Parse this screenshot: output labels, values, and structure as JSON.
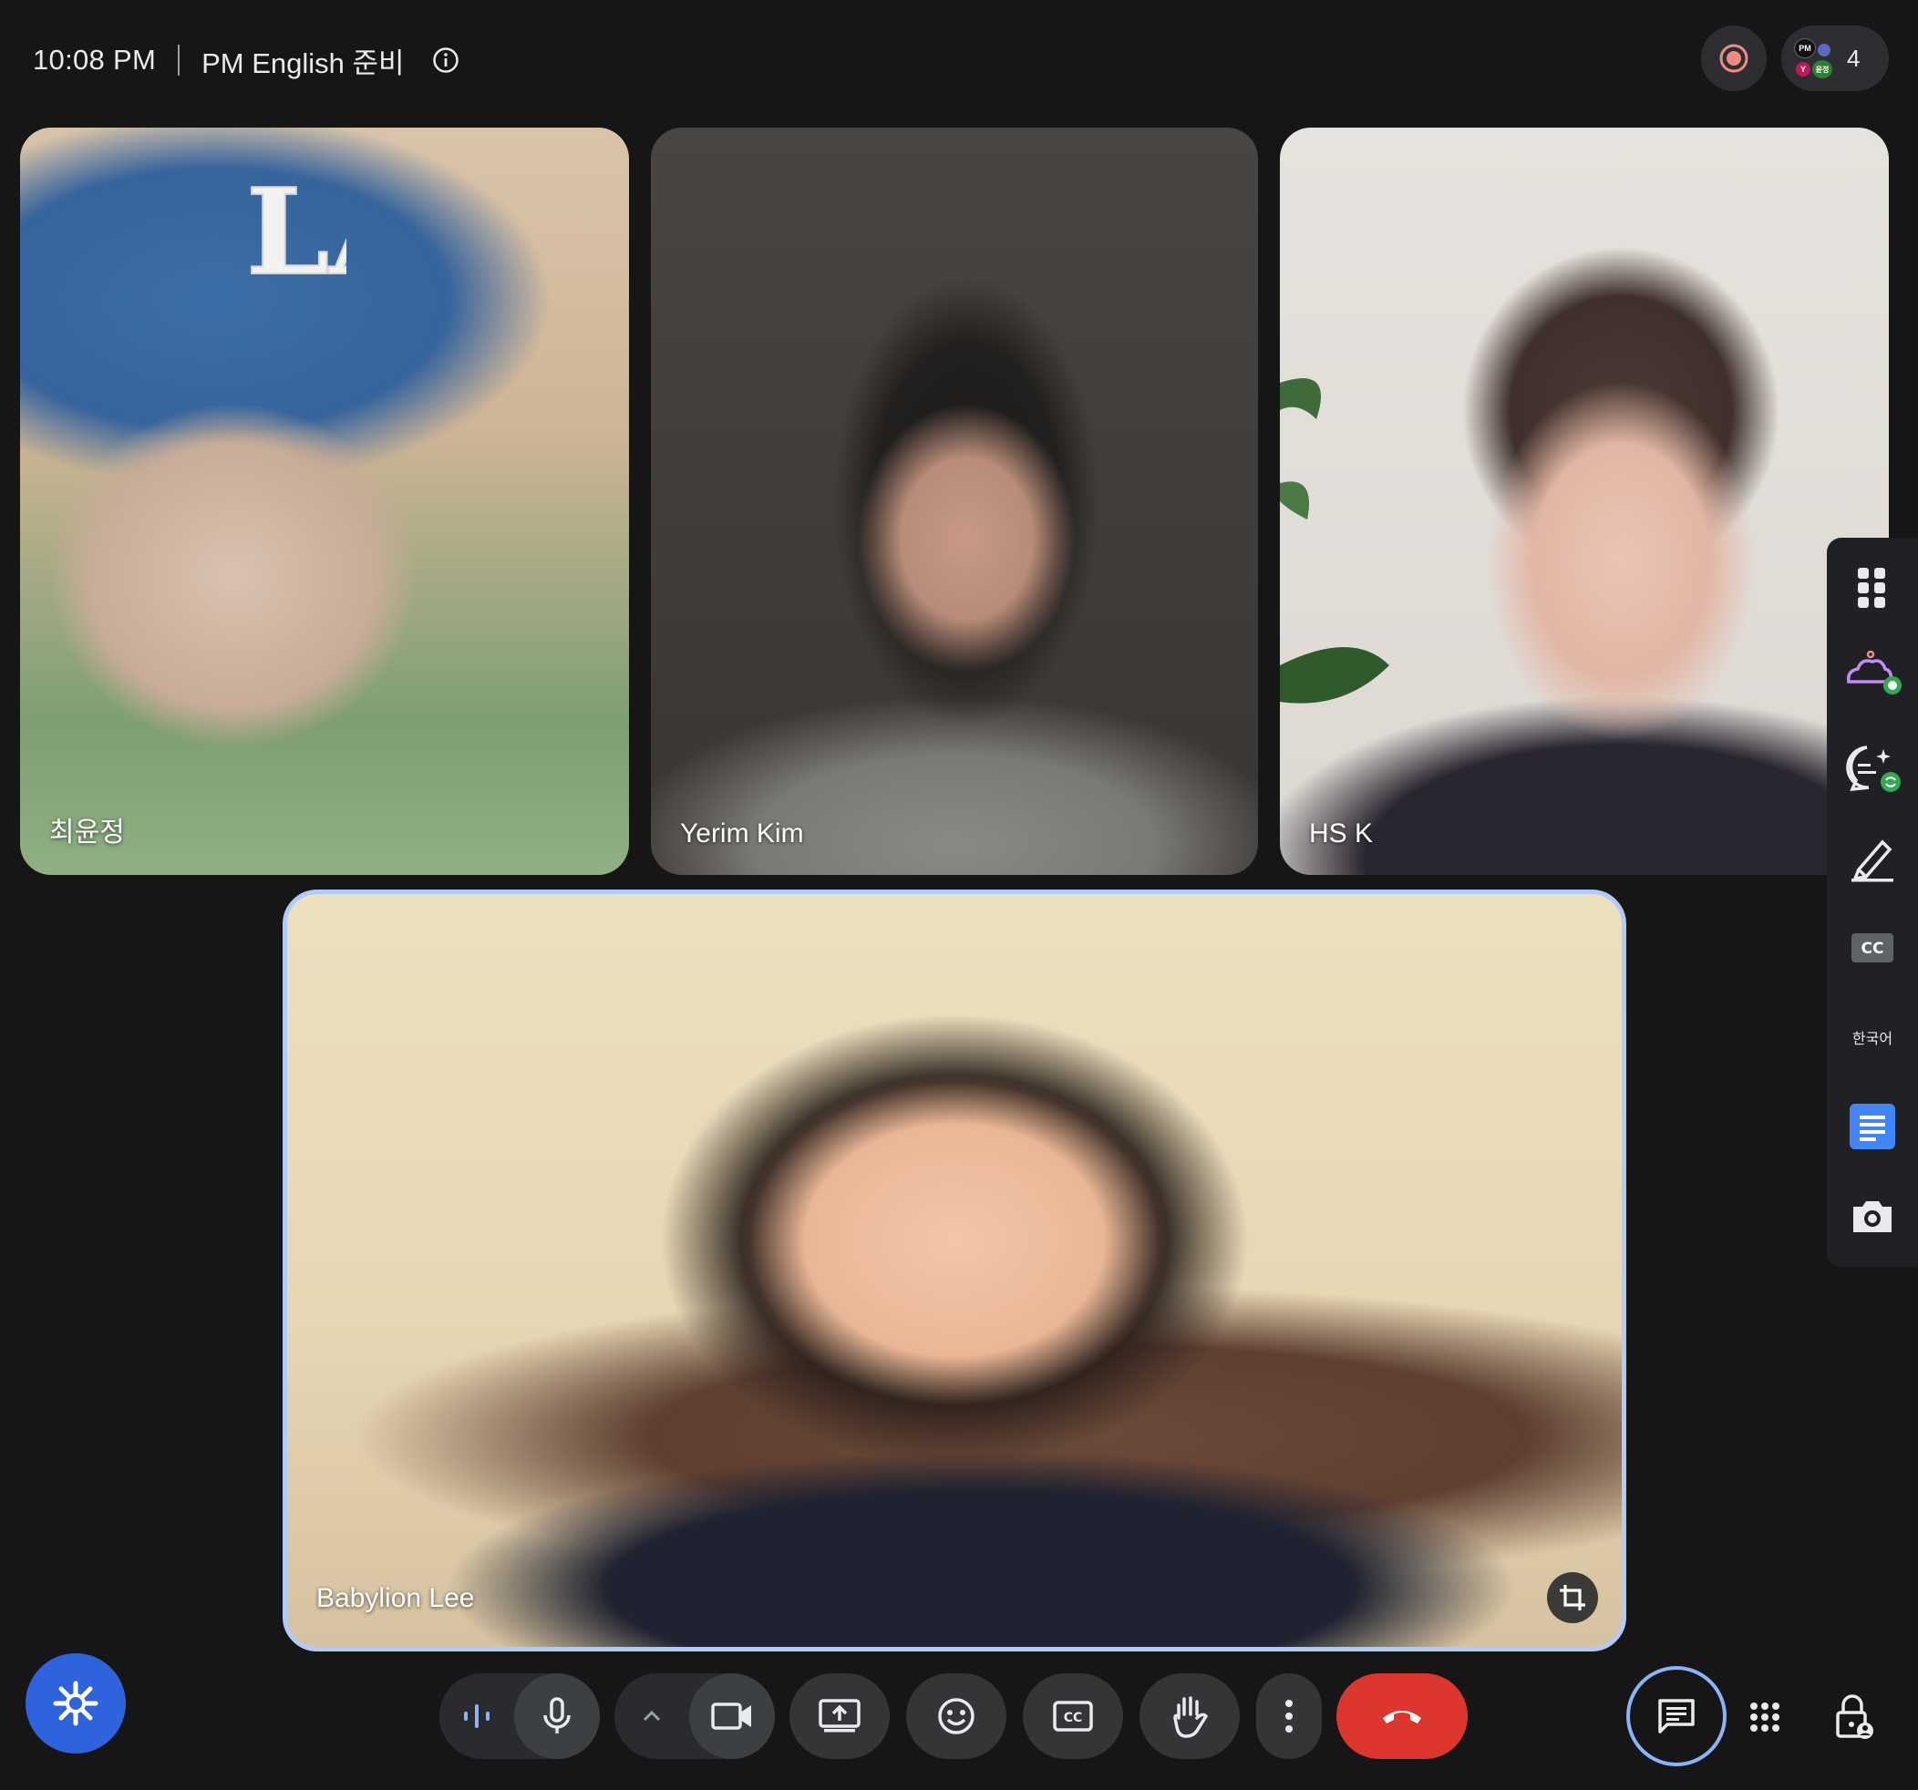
{
  "header": {
    "time": "10:08 PM",
    "meeting_title": "PM English 준비",
    "participant_count": "4",
    "avatar_labels": [
      "PM",
      "Y",
      "윤정"
    ]
  },
  "tiles": [
    {
      "name": "최윤정"
    },
    {
      "name": "Yerim Kim"
    },
    {
      "name": "HS K"
    },
    {
      "name": "Babylion Lee"
    }
  ],
  "side_panel": {
    "items": [
      "apps-grid-icon",
      "weather-effects-icon",
      "ai-notes-icon",
      "whiteboard-pen-icon",
      "closed-captions-icon",
      "caption-language",
      "docs-icon",
      "camera-snapshot-icon"
    ],
    "language_label": "한국어",
    "cc_label": "CC"
  },
  "controls": {
    "buttons": [
      "audio-levels",
      "microphone",
      "more-video-options",
      "camera",
      "present-screen",
      "reactions",
      "captions",
      "raise-hand",
      "more-options",
      "leave-call",
      "chat",
      "activities",
      "host-controls"
    ],
    "cc_label": "CC"
  },
  "colors": {
    "background": "#161616",
    "active_speaker_border": "#aecbfa",
    "end_call": "#dc362e",
    "assistant_button": "#2f62dd",
    "record_indicator": "#f28b82"
  }
}
